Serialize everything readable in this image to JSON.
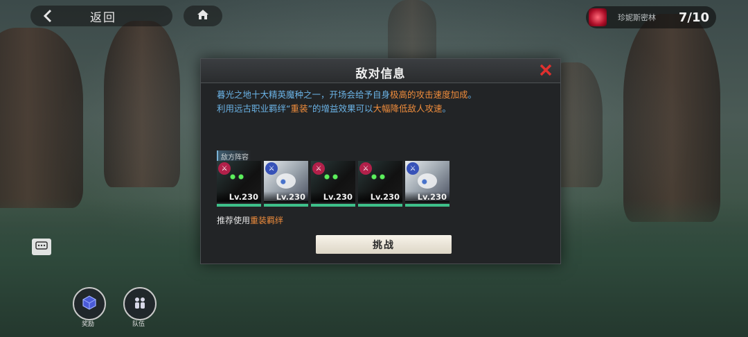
{
  "topbar": {
    "back_label": "返回",
    "stage_name": "珍妮斯密林",
    "stage_count": "7/10"
  },
  "dialog": {
    "title": "敌对信息",
    "desc_line1_part1": "暮光之地十大精英魔种之一，开场会给予自身",
    "desc_line1_hl": "极高的攻击速度加成",
    "desc_line1_end": "。",
    "desc_line2_part1": "利用远古职业羁绊“",
    "desc_line2_hl1": "重装",
    "desc_line2_part2": "”的增益效果可以",
    "desc_line2_hl2": "大幅降低敌人攻速",
    "desc_line2_end": "。",
    "section_label": "敌方阵容",
    "enemies": [
      {
        "level": "Lv.230",
        "faction": "red",
        "style": "dark"
      },
      {
        "level": "Lv.230",
        "faction": "blue",
        "style": "light"
      },
      {
        "level": "Lv.230",
        "faction": "red",
        "style": "dark"
      },
      {
        "level": "Lv.230",
        "faction": "red",
        "style": "dark"
      },
      {
        "level": "Lv.230",
        "faction": "blue",
        "style": "light"
      }
    ],
    "recommend_prefix": "推荐使用",
    "recommend_hl": "重装羁绊",
    "challenge_label": "挑战"
  },
  "bottom": {
    "reward_label": "奖励",
    "team_label": "队伍"
  },
  "colors": {
    "highlight": "#f08d3c",
    "desc": "#6bb3e6",
    "close": "#e0302e",
    "hp": "#3ec08a"
  }
}
